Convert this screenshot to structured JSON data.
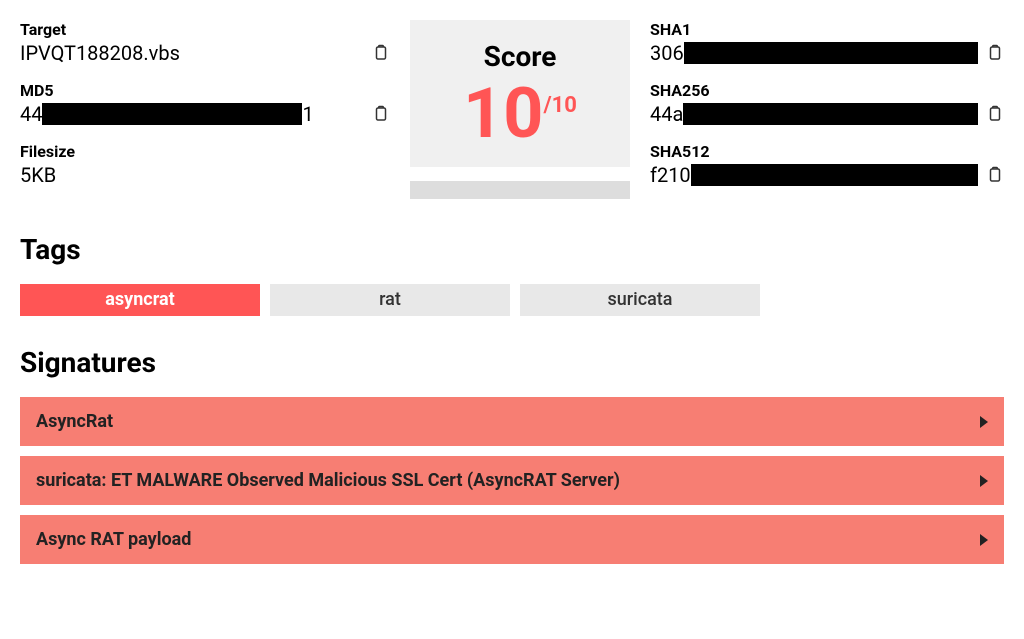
{
  "target": {
    "label": "Target",
    "value": "IPVQT188208.vbs"
  },
  "md5": {
    "label": "MD5",
    "prefix": "44",
    "suffix": "1"
  },
  "filesize": {
    "label": "Filesize",
    "value": "5KB"
  },
  "score": {
    "title": "Score",
    "value": "10",
    "max": "/10"
  },
  "sha1": {
    "label": "SHA1",
    "prefix": "306"
  },
  "sha256": {
    "label": "SHA256",
    "prefix": "44a"
  },
  "sha512": {
    "label": "SHA512",
    "prefix": "f210"
  },
  "sections": {
    "tags": "Tags",
    "signatures": "Signatures"
  },
  "tags": [
    {
      "label": "asyncrat",
      "active": true
    },
    {
      "label": "rat",
      "active": false
    },
    {
      "label": "suricata",
      "active": false
    }
  ],
  "signatures": [
    {
      "label": "AsyncRat"
    },
    {
      "label": "suricata: ET MALWARE Observed Malicious SSL Cert (AsyncRAT Server)"
    },
    {
      "label": "Async RAT payload"
    }
  ]
}
